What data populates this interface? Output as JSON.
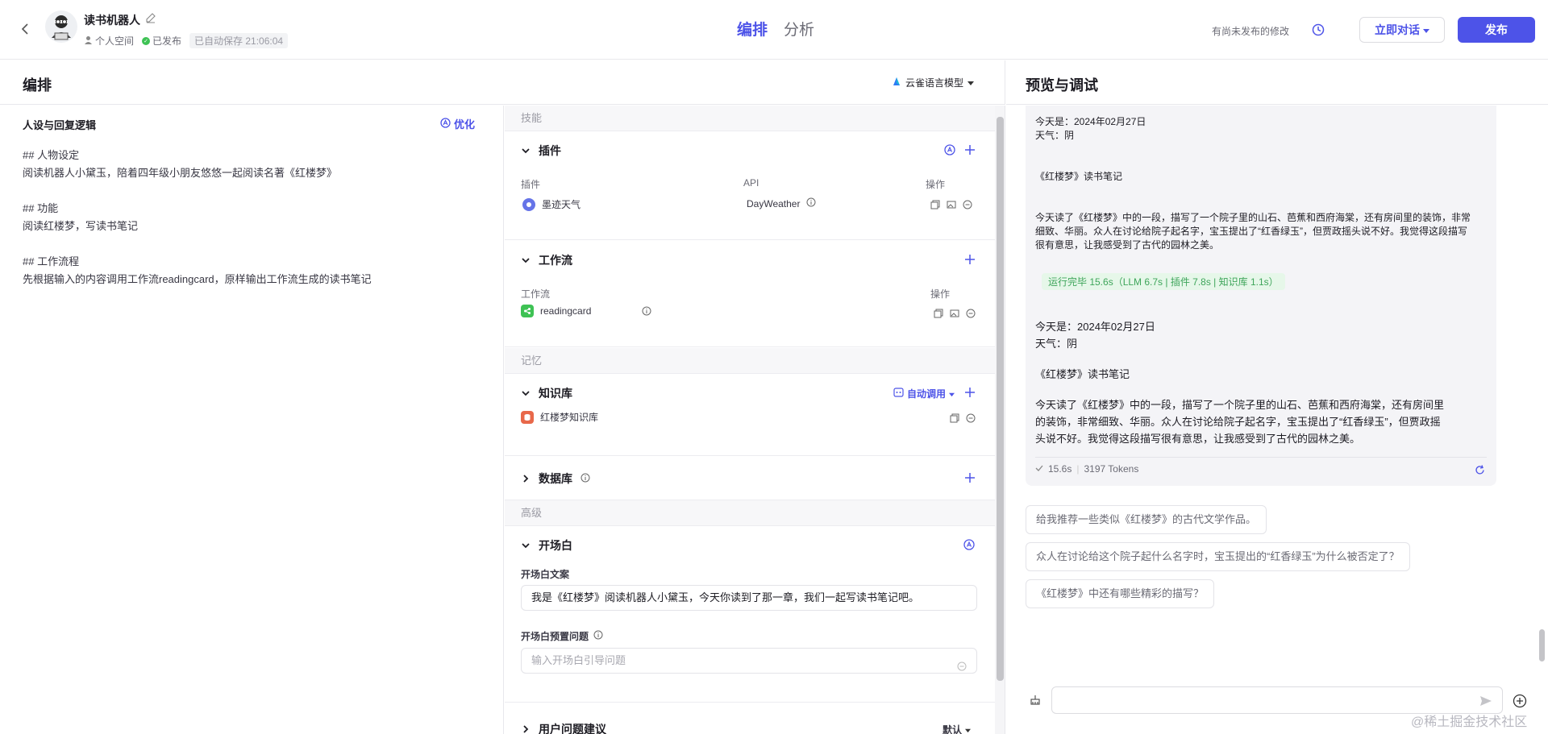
{
  "header": {
    "bot_name": "读书机器人",
    "space": "个人空间",
    "status": "已发布",
    "autosave": "已自动保存 21:06:04",
    "tabs": [
      {
        "label": "编排"
      },
      {
        "label": "分析"
      }
    ],
    "unpublished_note": "有尚未发布的修改",
    "chat_button": "立即对话",
    "publish_button": "发布"
  },
  "left_panel": {
    "title": "编排",
    "model": "云雀语言模型"
  },
  "persona": {
    "title": "人设与回复逻辑",
    "optimize": "优化",
    "lines": [
      "## 人物设定",
      "阅读机器人小黛玉，陪着四年级小朋友悠悠一起阅读名著《红楼梦》",
      "",
      "## 功能",
      "阅读红楼梦，写读书笔记",
      "",
      "## 工作流程",
      "先根据输入的内容调用工作流readingcard，原样输出工作流生成的读书笔记"
    ]
  },
  "skills": {
    "section_skills": "技能",
    "plugin": {
      "title": "插件",
      "col_plugin": "插件",
      "col_api": "API",
      "col_ops": "操作",
      "item_name": "墨迹天气",
      "item_api": "DayWeather"
    },
    "workflow": {
      "title": "工作流",
      "col_workflow": "工作流",
      "col_ops": "操作",
      "item_name": "readingcard"
    },
    "section_memory": "记忆",
    "knowledge": {
      "title": "知识库",
      "auto": "自动调用",
      "item_name": "红楼梦知识库"
    },
    "database": {
      "title": "数据库"
    },
    "section_advanced": "高级",
    "opening": {
      "title": "开场白",
      "text_label": "开场白文案",
      "text_value": "我是《红楼梦》阅读机器人小黛玉，今天你读到了那一章，我们一起写读书笔记吧。",
      "preset_label": "开场白预置问题",
      "preset_placeholder": "输入开场白引导问题"
    },
    "suggest": {
      "title": "用户问题建议",
      "value": "默认"
    }
  },
  "preview": {
    "title": "预览与调试",
    "card1": {
      "lines": [
        "今天是：2024年02月27日",
        "天气：阴",
        "",
        "",
        "《红楼梦》读书笔记",
        "",
        "",
        "今天读了《红楼梦》中的一段，描写了一个院子里的山石、芭蕉和西府海棠，还有房间里的装饰，非常",
        "细致、华丽。众人在讨论给院子起名字，宝玉提出了“红香绿玉”，但贾政摇头说不好。我觉得这段描写",
        "很有意思，让我感受到了古代的园林之美。"
      ],
      "run": "运行完毕 15.6s（LLM 6.7s | 插件 7.8s | 知识库 1.1s）"
    },
    "card2": {
      "lines": [
        "今天是：2024年02月27日",
        "天气：阴",
        "",
        "《红楼梦》读书笔记",
        "",
        "今天读了《红楼梦》中的一段，描写了一个院子里的山石、芭蕉和西府海棠，还有房间里",
        "的装饰，非常细致、华丽。众人在讨论给院子起名字，宝玉提出了“红香绿玉”，但贾政摇",
        "头说不好。我觉得这段描写很有意思，让我感受到了古代的园林之美。"
      ],
      "time": "15.6s",
      "tokens": "3197 Tokens"
    },
    "suggestions": [
      "给我推荐一些类似《红楼梦》的古代文学作品。",
      "众人在讨论给这个院子起什么名字时，宝玉提出的“红香绿玉”为什么被否定了？",
      "《红楼梦》中还有哪些精彩的描写？"
    ]
  },
  "watermark": "@稀土掘金技术社区"
}
